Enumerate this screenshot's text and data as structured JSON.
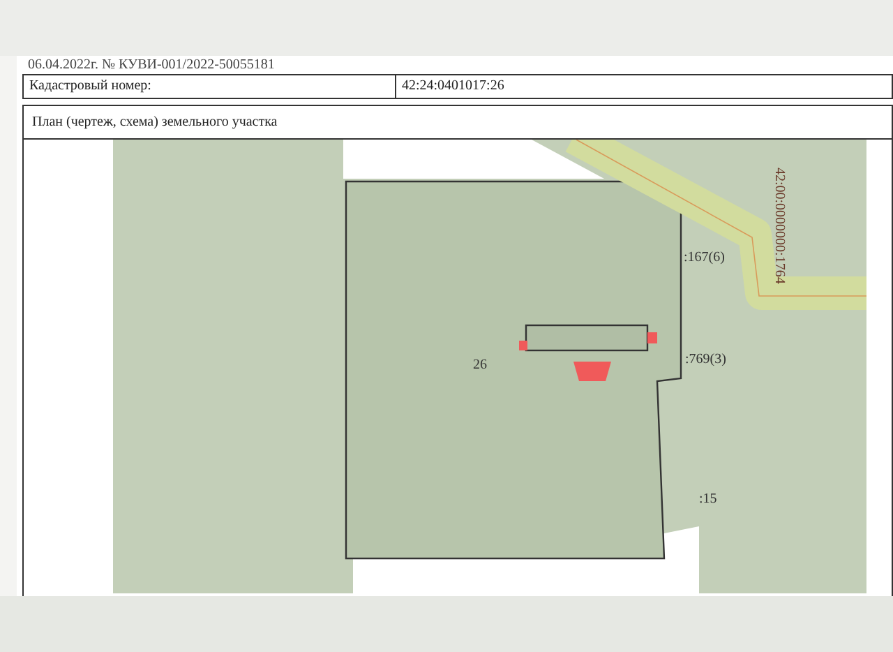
{
  "header_note": "06.04.2022г. № КУВИ-001/2022-50055181",
  "cadastral": {
    "label": "Кадастровый номер:",
    "value": "42:24:0401017:26"
  },
  "plan": {
    "title": "План (чертеж, схема) земельного участка",
    "road_label": "42:00:0000000:1764",
    "parcel_labels": [
      "26",
      ":167(6)",
      ":769(3)",
      ":15"
    ]
  }
}
